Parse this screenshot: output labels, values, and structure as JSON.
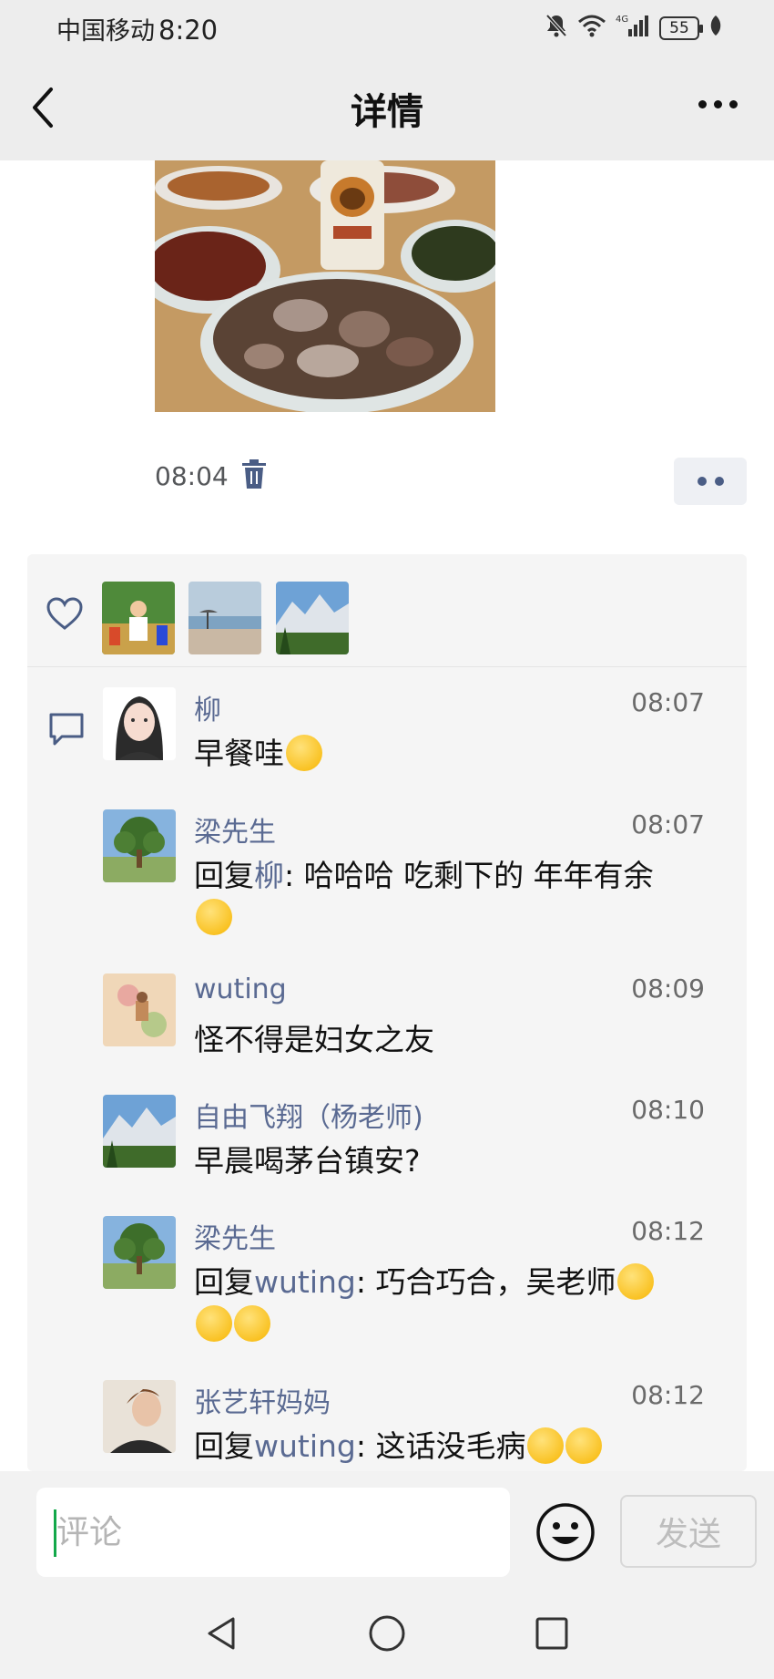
{
  "status_bar": {
    "carrier": "中国移动",
    "time": "8:20",
    "network": "4G",
    "battery": "55"
  },
  "nav": {
    "title": "详情",
    "back_icon": "chevron-left-icon",
    "more_icon": "more-horizontal-icon"
  },
  "post": {
    "image": "food-photo",
    "time": "08:04",
    "delete_icon": "trash-icon",
    "more_icon": "more-dots-icon"
  },
  "likes": {
    "icon": "heart-icon",
    "avatars": [
      "avatar-violinist",
      "avatar-beach",
      "avatar-mountains"
    ]
  },
  "comments": [
    {
      "name": "柳",
      "time": "08:07",
      "reply_word": "",
      "reply_to": "",
      "text": "早餐哇",
      "emojis": 1
    },
    {
      "name": "梁先生",
      "time": "08:07",
      "reply_word": "回复",
      "reply_to": "柳",
      "text": ": 哈哈哈 吃剩下的 年年有余",
      "emojis": 1
    },
    {
      "name": "wuting",
      "time": "08:09",
      "reply_word": "",
      "reply_to": "",
      "text": "怪不得是妇女之友",
      "emojis": 0
    },
    {
      "name": "自由飞翔（杨老师)",
      "time": "08:10",
      "reply_word": "",
      "reply_to": "",
      "text": "早晨喝茅台镇安?",
      "emojis": 0
    },
    {
      "name": "梁先生",
      "time": "08:12",
      "reply_word": "回复",
      "reply_to": "wuting",
      "text": ": 巧合巧合，吴老师",
      "emojis": 3
    },
    {
      "name": "张艺轩妈妈",
      "time": "08:12",
      "reply_word": "回复",
      "reply_to": "wuting",
      "text": ": 这话没毛病",
      "emojis": 2
    }
  ],
  "input": {
    "placeholder": "评论",
    "emoji_icon": "smiley-icon",
    "send_label": "发送"
  },
  "system_nav": {
    "back": "triangle-back-icon",
    "home": "circle-home-icon",
    "recents": "square-recents-icon"
  },
  "colors": {
    "nav_bg": "#ededed",
    "link_blue": "#5a6a92",
    "cursor_green": "#13a84a"
  }
}
